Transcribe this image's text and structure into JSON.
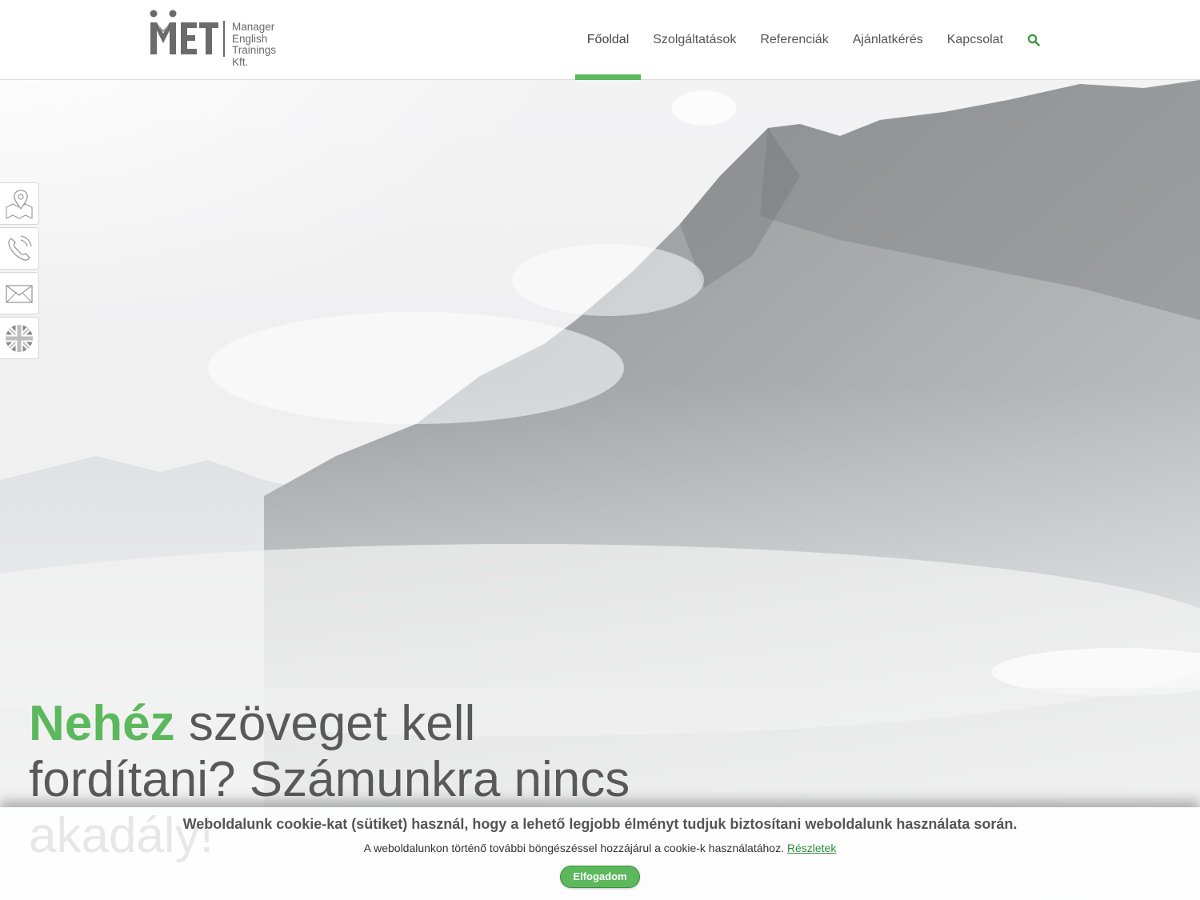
{
  "brand": {
    "name": "MET",
    "tagline_lines": [
      "Manager",
      "English",
      "Trainings",
      "Kft."
    ]
  },
  "nav": {
    "items": [
      {
        "label": "Főoldal",
        "active": true
      },
      {
        "label": "Szolgáltatások",
        "active": false
      },
      {
        "label": "Referenciák",
        "active": false
      },
      {
        "label": "Ajánlatkérés",
        "active": false
      },
      {
        "label": "Kapcsolat",
        "active": false
      }
    ],
    "search_icon": "search-icon"
  },
  "side_icons": [
    "map-pin-icon",
    "phone-icon",
    "envelope-icon",
    "uk-flag-icon"
  ],
  "hero": {
    "headline_strong": "Nehéz",
    "headline_rest": " szöveget kell fordítani? Számunkra nincs akadály!"
  },
  "cookie": {
    "title": "Weboldalunk cookie-kat (sütiket) használ, hogy a lehető legjobb élményt tudjuk biztosítani weboldalunk használata során.",
    "text": "A weboldalunkon történő további böngészéssel hozzájárul a cookie-k használatához. ",
    "link_label": "Részletek",
    "accept_label": "Elfogadom"
  },
  "colors": {
    "accent": "#5cb85c",
    "nav_text": "#555555",
    "headline_text": "#595959"
  }
}
